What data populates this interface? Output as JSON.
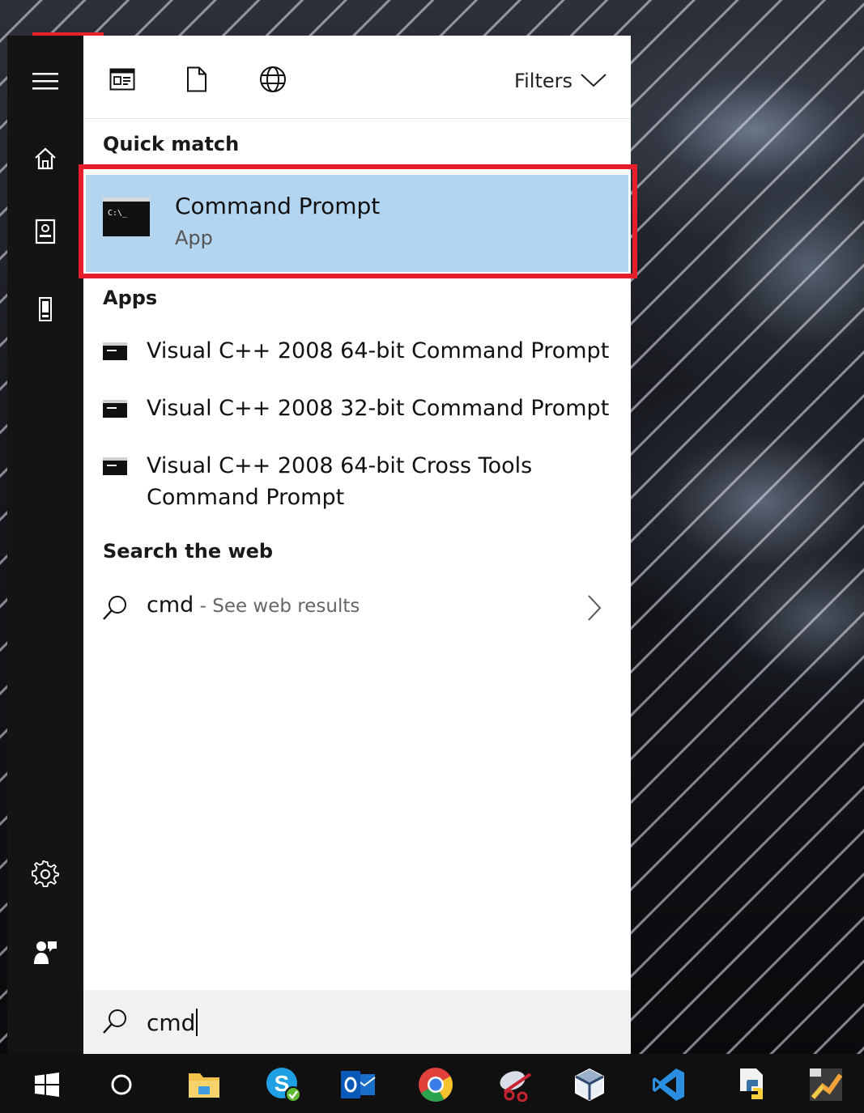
{
  "toolbar": {
    "filters_label": "Filters",
    "icons": [
      "apps-filter-icon",
      "documents-filter-icon",
      "web-filter-icon",
      "chevron-down-icon"
    ]
  },
  "rail": {
    "icons": [
      "hamburger-menu-icon",
      "home-icon",
      "notebook-icon",
      "device-icon",
      "settings-gear-icon",
      "feedback-icon"
    ]
  },
  "quick_match": {
    "heading": "Quick match",
    "title": "Command Prompt",
    "subtitle": "App",
    "icon_text": "C:\\_"
  },
  "apps": {
    "heading": "Apps",
    "items": [
      {
        "label": "Visual C++ 2008 64-bit Command Prompt"
      },
      {
        "label": "Visual C++ 2008 32-bit Command Prompt"
      },
      {
        "label_line1": "Visual C++ 2008 64-bit Cross Tools",
        "label_line2": "Command Prompt"
      }
    ]
  },
  "web": {
    "heading": "Search the web",
    "query": "cmd",
    "suffix": " - See web results"
  },
  "search": {
    "value": "cmd"
  },
  "taskbar": {
    "icons": [
      "windows-start-icon",
      "cortana-icon",
      "file-explorer-icon",
      "skype-icon",
      "outlook-icon",
      "chrome-icon",
      "snipping-tool-icon",
      "virtualbox-icon",
      "vscode-icon",
      "python-icon",
      "app-icon"
    ]
  },
  "colors": {
    "highlight": "#b4d5f0",
    "annotation_border": "#e61d2b",
    "accent": "#e8202a"
  }
}
